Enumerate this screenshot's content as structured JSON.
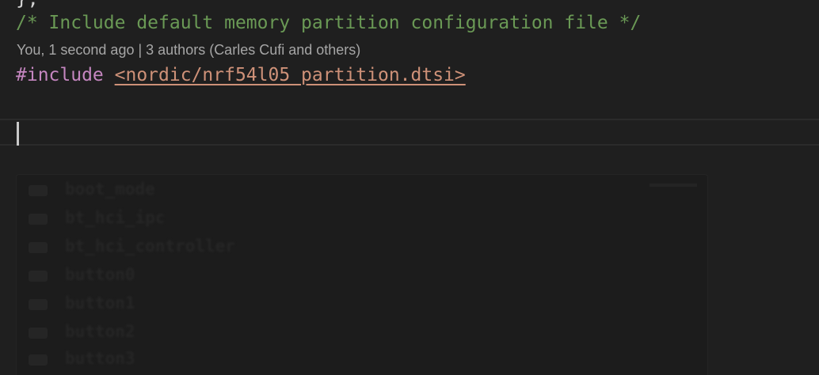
{
  "editor": {
    "partial_line": "};",
    "comment": "/* Include default memory partition configuration file */",
    "blame": "You, 1 second ago | 3 authors (Carles Cufi and others)",
    "include_keyword": "#include",
    "include_path": "<nordic/nrf54l05_partition.dtsi>"
  },
  "colors": {
    "background": "#1f1f1f",
    "comment": "#6a9955",
    "keyword": "#c586c0",
    "string": "#ce9178",
    "blame": "#a6a6a6"
  },
  "suggestions": [
    {
      "label": "boot_mode",
      "icon": "symbol-icon"
    },
    {
      "label": "bt_hci_ipc",
      "icon": "symbol-icon"
    },
    {
      "label": "bt_hci_controller",
      "icon": "symbol-icon"
    },
    {
      "label": "button0",
      "icon": "symbol-icon"
    },
    {
      "label": "button1",
      "icon": "symbol-icon"
    },
    {
      "label": "button2",
      "icon": "symbol-icon"
    },
    {
      "label": "button3",
      "icon": "symbol-icon"
    }
  ]
}
